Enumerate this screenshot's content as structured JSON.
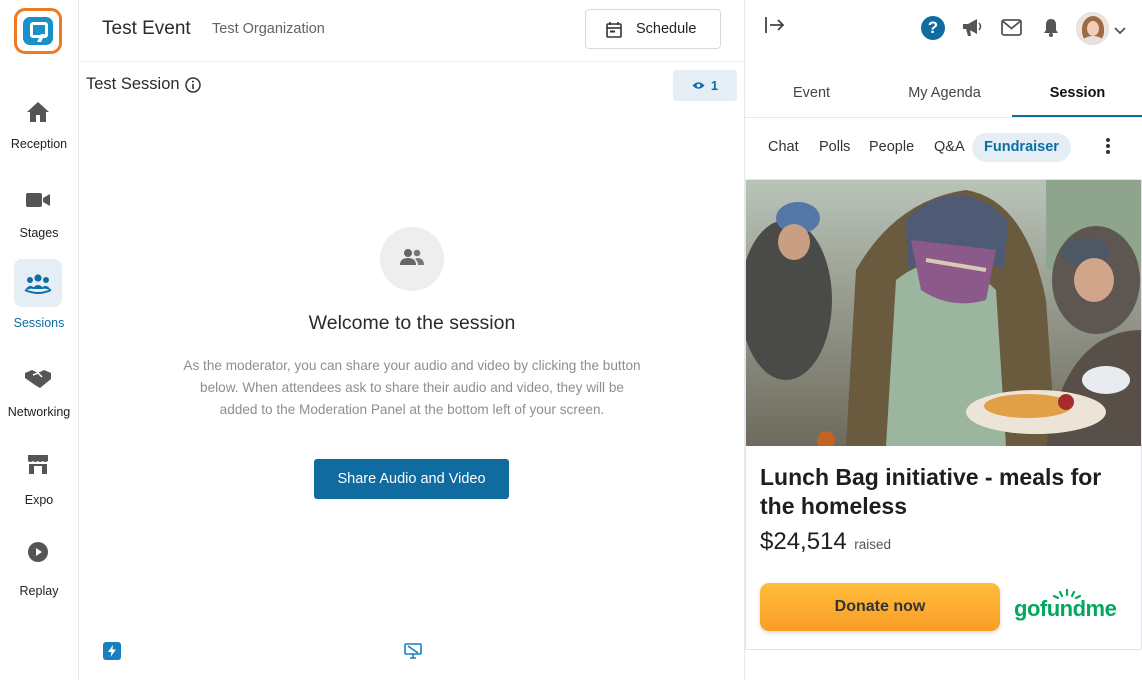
{
  "nav": {
    "items": [
      {
        "label": "Reception",
        "icon": "home-icon"
      },
      {
        "label": "Stages",
        "icon": "video-camera-icon"
      },
      {
        "label": "Sessions",
        "icon": "group-icon",
        "active": true
      },
      {
        "label": "Networking",
        "icon": "handshake-icon"
      },
      {
        "label": "Expo",
        "icon": "store-icon"
      },
      {
        "label": "Replay",
        "icon": "play-circle-icon"
      }
    ]
  },
  "header": {
    "event_title": "Test Event",
    "organization": "Test Organization",
    "schedule_label": "Schedule"
  },
  "session": {
    "title": "Test Session",
    "viewer_count": "1",
    "welcome": "Welcome to the session",
    "description": "As the moderator, you can share your audio and video by clicking the button below. When attendees ask to share their audio and video, they will be added to the Moderation Panel at the bottom left of your screen.",
    "share_button": "Share Audio and Video"
  },
  "panel": {
    "tabs": [
      "Event",
      "My Agenda",
      "Session"
    ],
    "active_tab": "Session",
    "sub_tabs": [
      "Chat",
      "Polls",
      "People",
      "Q&A",
      "Fundraiser"
    ],
    "active_sub_tab": "Fundraiser"
  },
  "fundraiser": {
    "title": "Lunch Bag initiative - meals for the homeless",
    "amount": "$24,514",
    "raised_label": "raised",
    "donate_label": "Donate now",
    "brand": "gofundme"
  },
  "colors": {
    "accent": "#0f6ba0",
    "logo_orange": "#f07a22",
    "donate": "#f9a92e",
    "brand_green": "#02a95c"
  }
}
